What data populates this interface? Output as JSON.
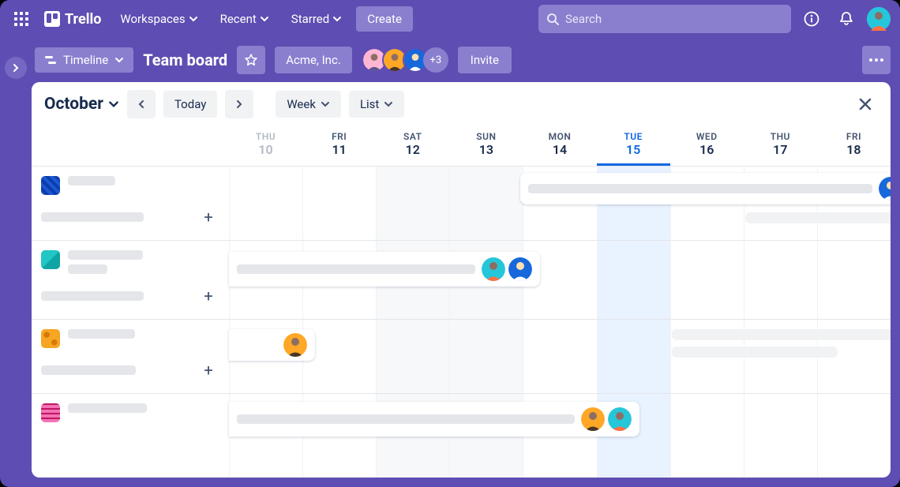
{
  "topnav": {
    "app_name": "Trello",
    "menus": {
      "workspaces": "Workspaces",
      "recent": "Recent",
      "starred": "Starred"
    },
    "create": "Create",
    "search_placeholder": "Search"
  },
  "boardbar": {
    "view_label": "Timeline",
    "board_title": "Team board",
    "org_name": "Acme, Inc.",
    "member_overflow": "+3",
    "invite": "Invite"
  },
  "calendar": {
    "month": "October",
    "today_btn": "Today",
    "view_range": "Week",
    "view_mode": "List",
    "days": [
      {
        "name": "THU",
        "num": "10",
        "state": "past"
      },
      {
        "name": "FRI",
        "num": "11",
        "state": ""
      },
      {
        "name": "SAT",
        "num": "12",
        "state": "weekend"
      },
      {
        "name": "SUN",
        "num": "13",
        "state": "weekend"
      },
      {
        "name": "MON",
        "num": "14",
        "state": ""
      },
      {
        "name": "TUE",
        "num": "15",
        "state": "today"
      },
      {
        "name": "WED",
        "num": "16",
        "state": ""
      },
      {
        "name": "THU",
        "num": "17",
        "state": ""
      },
      {
        "name": "FRI",
        "num": "18",
        "state": ""
      }
    ]
  },
  "list_colors": {
    "row1": "#1d57d9",
    "row2": "#21c6c5",
    "row3": "#f5a623",
    "row4": "#f472b6"
  },
  "avatar_colors": {
    "pink": "#ffb6d5",
    "orange": "#ffa726",
    "blue": "#1868db",
    "cyan": "#26c6da",
    "light": "#ecedf0"
  }
}
